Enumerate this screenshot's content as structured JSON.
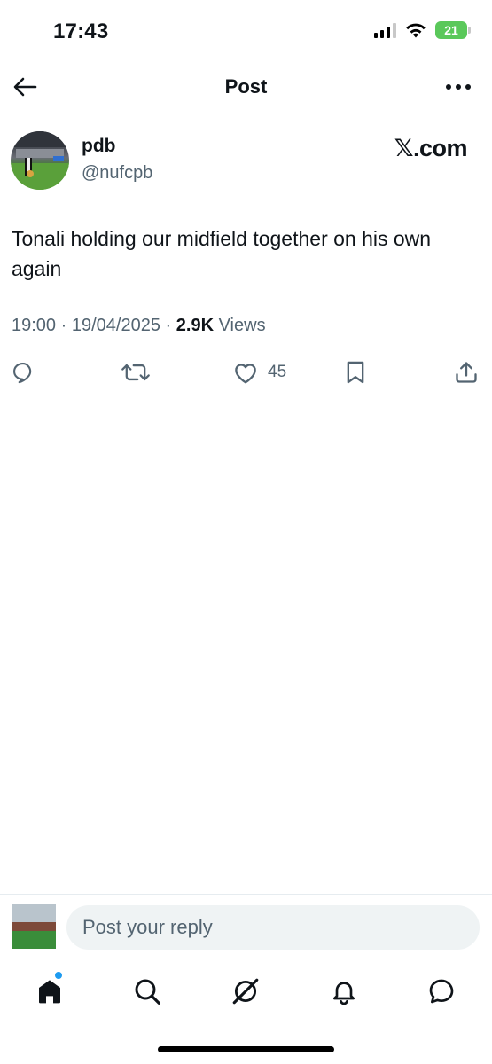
{
  "status_bar": {
    "time": "17:43",
    "battery": "21"
  },
  "header": {
    "title": "Post"
  },
  "author": {
    "name": "pdb",
    "handle": "@nufcpb"
  },
  "watermark": "𝕏.com",
  "post": {
    "text": "Tonali holding our midfield together on his own again",
    "time": "19:00",
    "date": "19/04/2025",
    "views_count": "2.9K",
    "views_label": "Views",
    "separator": "·"
  },
  "actions": {
    "likes": "45"
  },
  "reply": {
    "placeholder": "Post your reply"
  },
  "icons": {
    "back": "arrow-left-icon",
    "more": "more-icon",
    "reply": "reply-icon",
    "repost": "repost-icon",
    "like": "heart-icon",
    "bookmark": "bookmark-icon",
    "share": "share-icon",
    "home": "home-icon",
    "search": "search-icon",
    "grok": "grok-icon",
    "notifications": "bell-icon",
    "messages": "messages-icon"
  },
  "colors": {
    "accent": "#1d9bf0",
    "text": "#0f1419",
    "muted": "#536471",
    "battery": "#5ac85a"
  }
}
